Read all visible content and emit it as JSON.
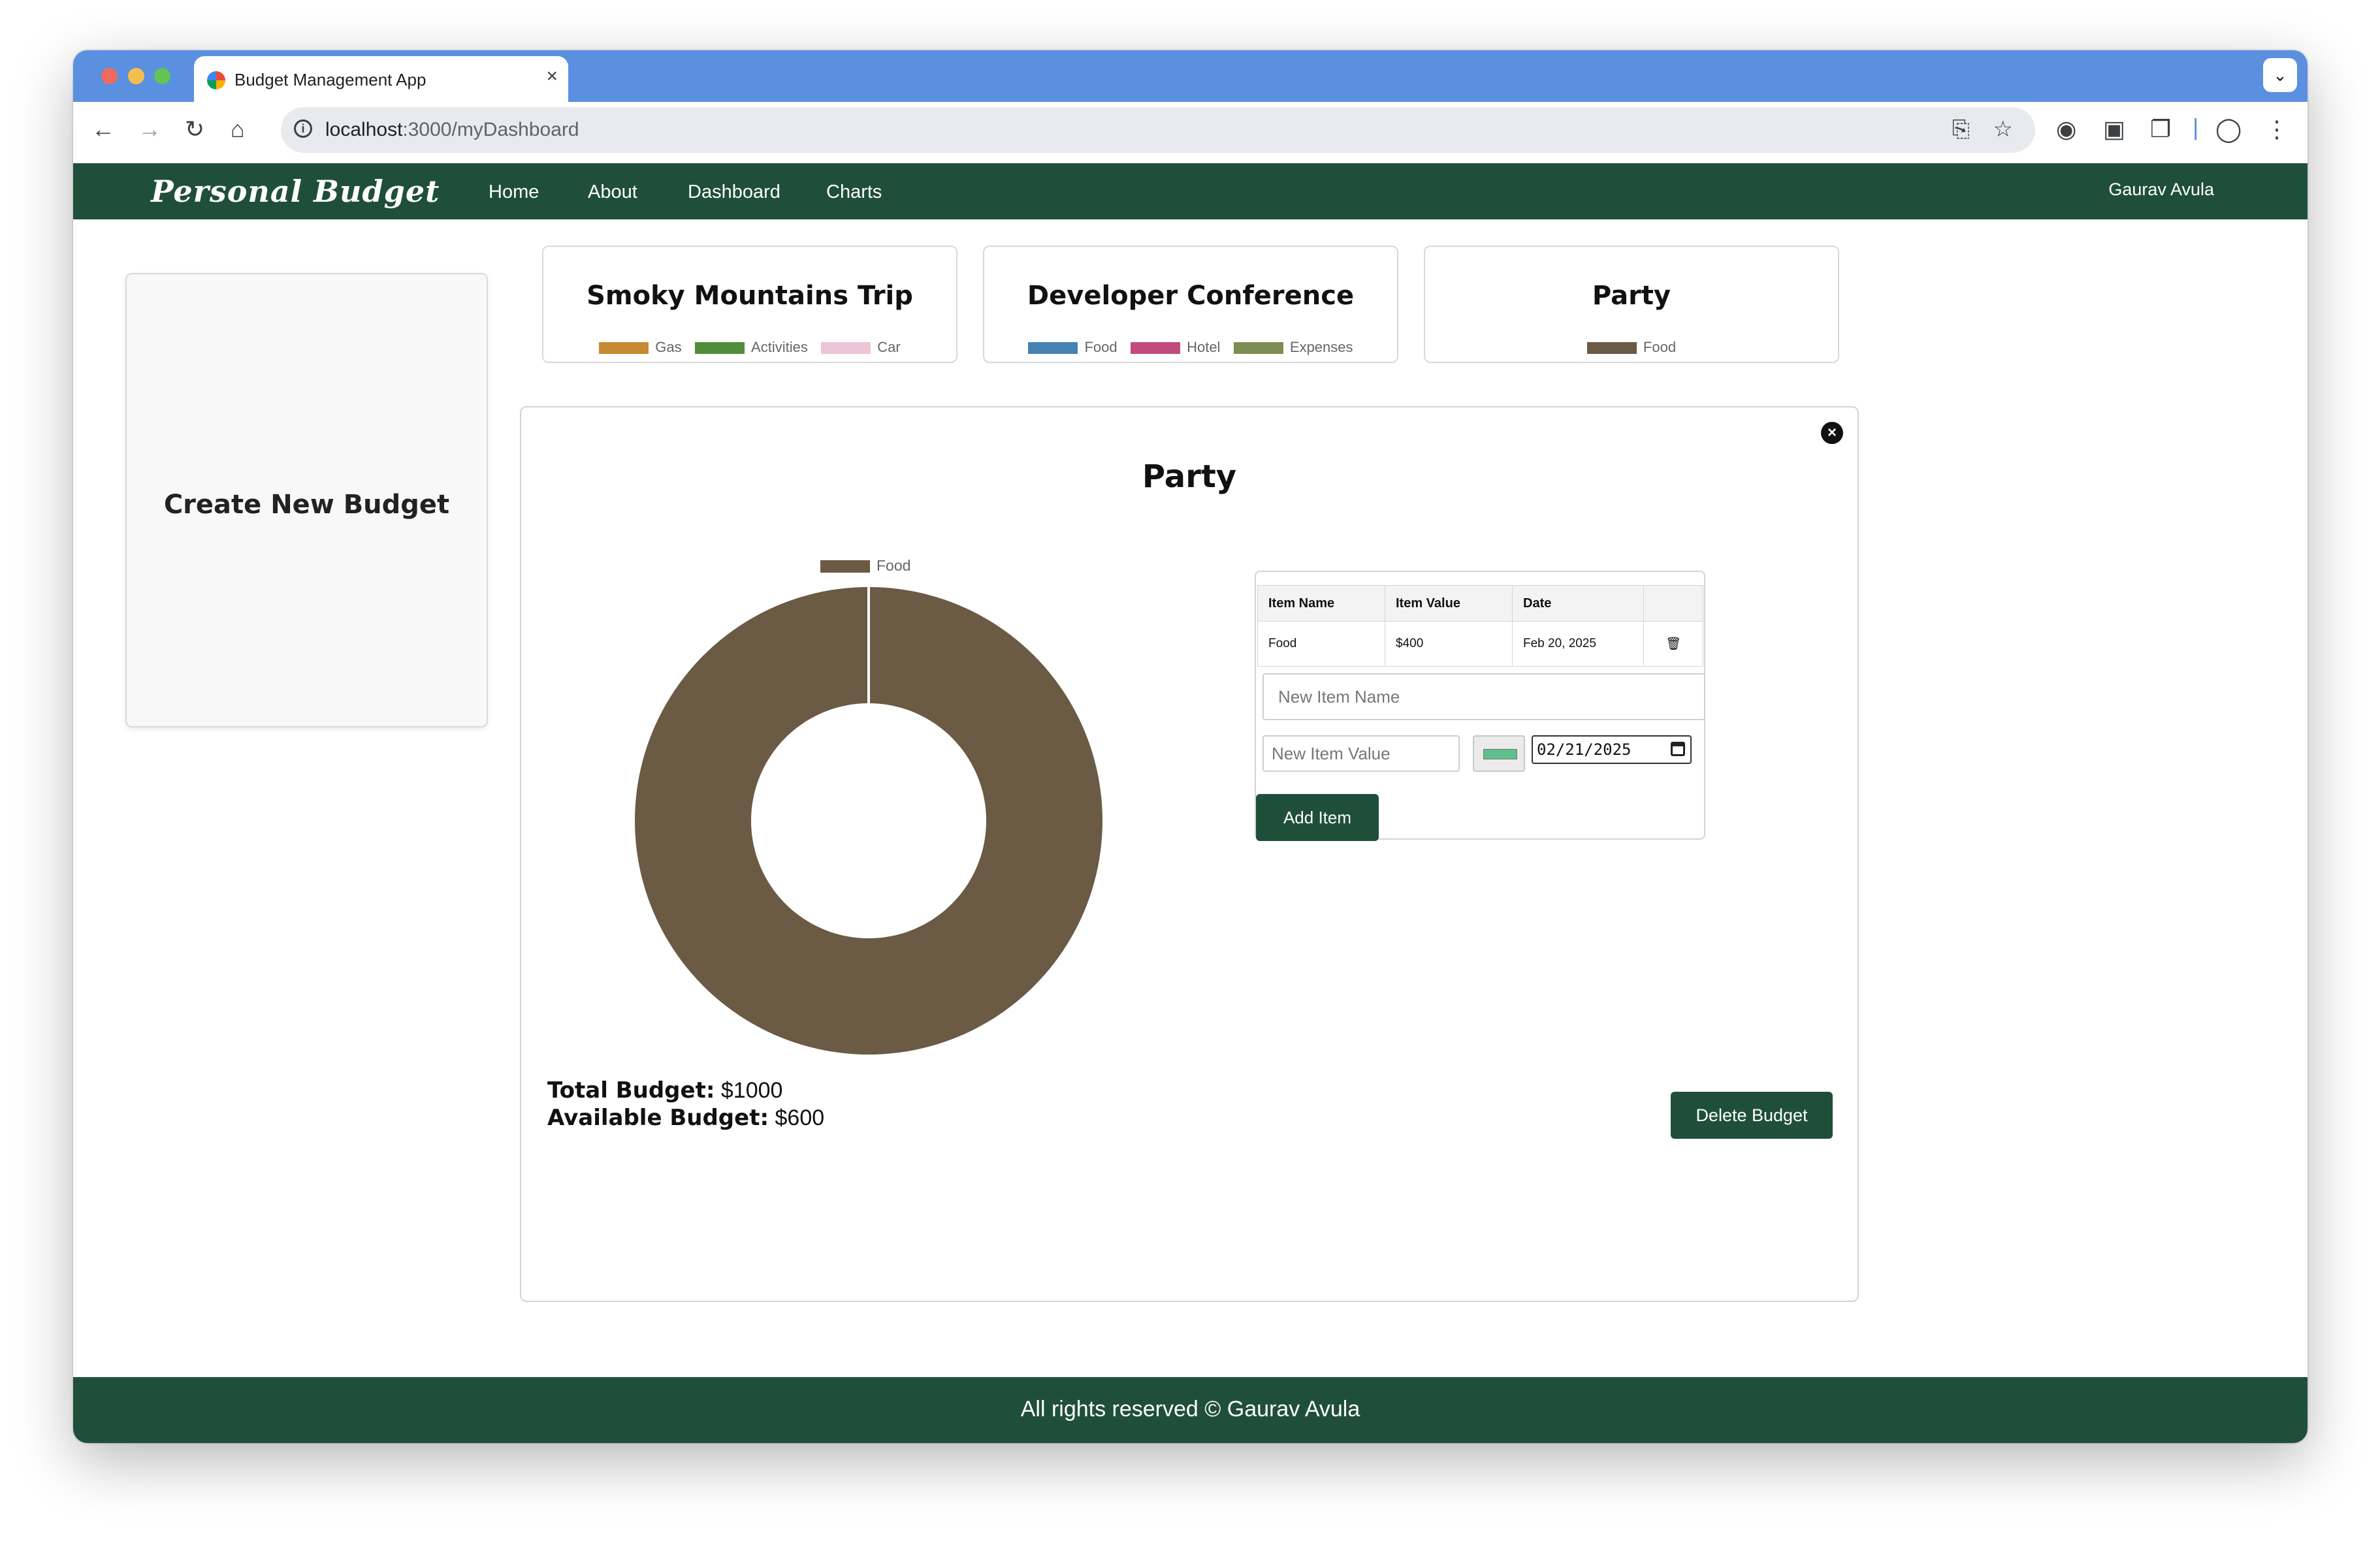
{
  "browser": {
    "tab_title": "Budget Management App",
    "tab_close": "×",
    "new_tab": "+",
    "tab_menu": "⌄",
    "url_host": "localhost",
    "url_path": ":3000/myDashboard"
  },
  "nav": {
    "brand": "Personal Budget",
    "links": [
      "Home",
      "About",
      "Dashboard",
      "Charts"
    ],
    "user": "Gaurav Avula"
  },
  "create_card": {
    "label": "Create New Budget"
  },
  "budgets": [
    {
      "title": "Smoky Mountains Trip",
      "legend": [
        {
          "label": "Gas",
          "color": "#c68a32"
        },
        {
          "label": "Activities",
          "color": "#4f8d3a"
        },
        {
          "label": "Car",
          "color": "#ebc4d6"
        }
      ]
    },
    {
      "title": "Developer Conference",
      "legend": [
        {
          "label": "Food",
          "color": "#4682b4"
        },
        {
          "label": "Hotel",
          "color": "#c24b7e"
        },
        {
          "label": "Expenses",
          "color": "#7d8c52"
        }
      ]
    },
    {
      "title": "Party",
      "legend": [
        {
          "label": "Food",
          "color": "#6b5a44"
        }
      ]
    }
  ],
  "modal": {
    "title": "Party",
    "close_icon": "×",
    "table": {
      "headers": [
        "Item Name",
        "Item Value",
        "Date",
        ""
      ],
      "rows": [
        {
          "name": "Food",
          "value": "$400",
          "date": "Feb 20, 2025"
        }
      ]
    },
    "new_item_name_placeholder": "New Item Name",
    "new_item_value_placeholder": "New Item Value",
    "new_item_color": "#5fbf8d",
    "date_value": "02/21/2025",
    "add_item_label": "Add Item",
    "total_label": "Total Budget:",
    "total_value": "$1000",
    "available_label": "Available Budget:",
    "available_value": "$600",
    "delete_label": "Delete Budget"
  },
  "chart_data": {
    "type": "pie",
    "categories": [
      "Food"
    ],
    "values": [
      400
    ],
    "colors": [
      "#6b5a44"
    ],
    "legend": "top"
  },
  "footer": {
    "text": "All rights reserved © Gaurav Avula"
  }
}
